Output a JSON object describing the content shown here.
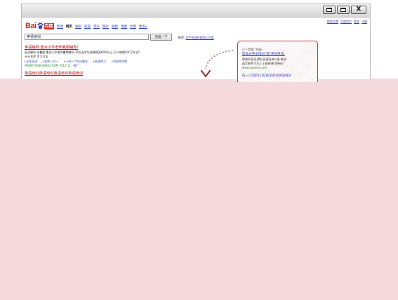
{
  "window": {
    "controls": {
      "minimize_icon": "minimize-icon",
      "maximize_icon": "maximize-icon",
      "close_glyph": "X"
    }
  },
  "baidu": {
    "logo": {
      "bai": "Bai",
      "paw_icon": "paw-icon",
      "du": "百度",
      "brand_color": "#d92a22"
    },
    "nav": [
      "新闻",
      "网页",
      "贴吧",
      "知道",
      "音乐",
      "图片",
      "视频",
      "地图",
      "文库",
      "更多»"
    ],
    "nav_active": "网页",
    "top_links": [
      "搜索设置",
      "百度首页",
      "登录",
      "注册"
    ],
    "search": {
      "value": "英语培训",
      "button": "百度一下"
    },
    "recommend": {
      "label": "推荐:",
      "link": "用手机随时随地上百度"
    }
  },
  "results": {
    "first": {
      "title": "英语辅导 重点小学老师暑期辅导!",
      "desc_line1": "英语辅导 给暑假 重点小学老师暑期辅导,30天去学生成绩提高60%以上,2小时辅导学习方法!!",
      "desc_line2": "天天名师 学习方法",
      "sitelinks": [
        "五年英语",
        "名师一对一",
        "一对一个性化辅导",
        "新课预习",
        "中高考冲刺"
      ],
      "url": "WWW.TIANCAIEDU.COM 2012-11",
      "url_extra": "- 推广"
    },
    "second": {
      "title": "英语培训英语培训英语培训英语培训"
    }
  },
  "ad_panel": {
    "label": "以下是推广链接",
    "title": "欧美式英语培训\"疯\"英语英语,",
    "desc_line1": "即刻学英语,提升英语培训口语,来自",
    "desc_line2": "英文老师 4,6,1 小班授课 简单化!",
    "url": "www.xxxedu.com",
    "bottom_link": "成一口流利口语,就学英语英语培训"
  },
  "colors": {
    "accent_blue": "#2a3fd0",
    "highlight_red": "#dd0000",
    "ad_border": "#c8333a",
    "background_fill": "#f4dadc"
  }
}
